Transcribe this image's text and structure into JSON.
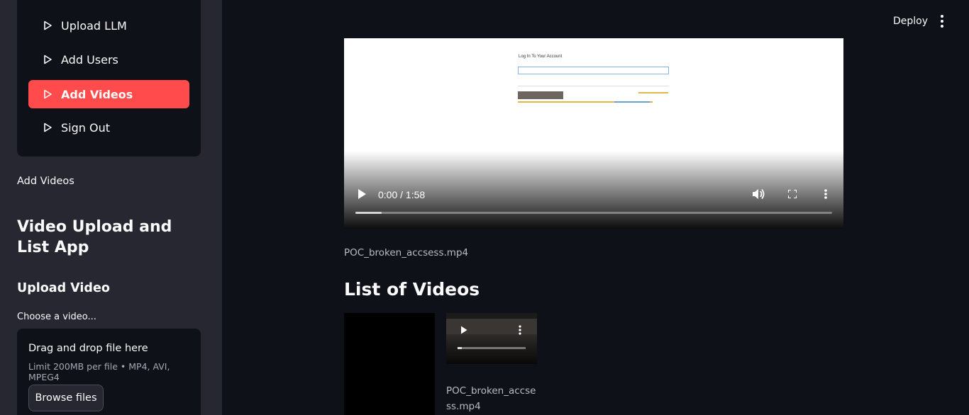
{
  "sidebar": {
    "nav": [
      {
        "label": "Upload LLM",
        "active": false
      },
      {
        "label": "Add Users",
        "active": false
      },
      {
        "label": "Add Videos",
        "active": true
      },
      {
        "label": "Sign Out",
        "active": false
      }
    ],
    "page_label": "Add Videos",
    "app_title": "Video Upload and List App",
    "upload_heading": "Upload Video",
    "uploader": {
      "label": "Choose a video...",
      "drop_text": "Drag and drop file here",
      "limit_text": "Limit 200MB per file • MP4, AVI, MPEG4",
      "browse_label": "Browse files"
    }
  },
  "header": {
    "deploy_label": "Deploy",
    "menu_icon": "kebab-menu-icon"
  },
  "main": {
    "player": {
      "time": "0:00 / 1:58",
      "progress_fraction": 0.055,
      "filename": "POC_broken_accsess.mp4"
    },
    "list_title": "List of Videos",
    "videos": [
      {
        "caption": ""
      },
      {
        "caption": "POC_broken_accsess.mp4"
      }
    ]
  },
  "colors": {
    "accent": "#ff4b4b",
    "sidebar_bg": "#262730",
    "main_bg": "#0e1117"
  }
}
